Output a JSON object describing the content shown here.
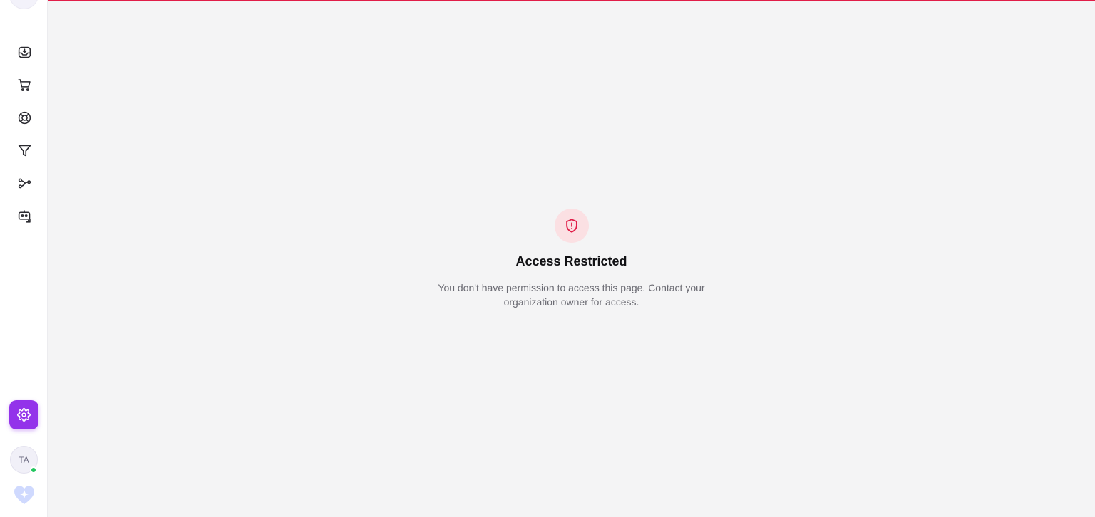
{
  "sidebar": {
    "items": [
      {
        "icon": "inbox-download-icon",
        "name": "nav-inbox"
      },
      {
        "icon": "shopping-cart-icon",
        "name": "nav-cart"
      },
      {
        "icon": "lifebuoy-icon",
        "name": "nav-support"
      },
      {
        "icon": "filter-icon",
        "name": "nav-filter"
      },
      {
        "icon": "workflow-nodes-icon",
        "name": "nav-workflows"
      },
      {
        "icon": "bot-icon",
        "name": "nav-bot"
      }
    ],
    "settings_icon": "gear-icon",
    "avatar_initials": "TA",
    "status": "online",
    "assistant_icon": "sparkle-heart-icon"
  },
  "colors": {
    "accent": "#9333ea",
    "danger": "#e11d48",
    "online": "#22c55e"
  },
  "main": {
    "icon": "shield-alert-icon",
    "title": "Access Restricted",
    "message": "You don't have permission to access this page. Contact your organization owner for access."
  }
}
